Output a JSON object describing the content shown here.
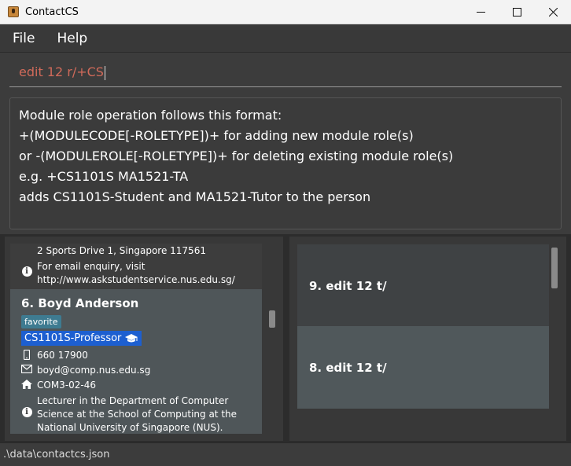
{
  "window": {
    "title": "ContactCS",
    "minimize": "—",
    "maximize": "☐",
    "close": "✕"
  },
  "menu": {
    "file": "File",
    "help": "Help"
  },
  "command": {
    "value": "edit 12 r/+CS"
  },
  "result": {
    "lines": [
      "Module role operation follows this format:",
      "+(MODULECODE[-ROLETYPE])+ for adding new module role(s)",
      "or -(MODULEROLE[-ROLETYPE])+ for deleting existing module role(s)",
      "e.g. +CS1101S MA1521-TA",
      "adds CS1101S-Student and MA1521-Tutor to the person"
    ]
  },
  "person_list": {
    "previous": {
      "address": "2 Sports Drive 1, Singapore 117561",
      "description_1": "For email enquiry, visit",
      "description_2": "http://www.askstudentservice.nus.edu.sg/"
    },
    "selected": {
      "name": "6. Boyd Anderson",
      "tag": "favorite",
      "role": "CS1101S-Professor",
      "role_icon": "graduation-cap-icon",
      "phone": "660 17900",
      "email": "boyd@comp.nus.edu.sg",
      "address": "COM3-02-46",
      "description_1": "Lecturer in the Department of Computer",
      "description_2": "Science at the School of Computing at the",
      "description_3": "National University of Singapore (NUS)."
    }
  },
  "history": {
    "items": [
      "9. edit 12 t/",
      "8. edit 12 t/"
    ]
  },
  "status": {
    "file_path": ".\\data\\contactcs.json"
  },
  "colors": {
    "background": "#3c3c3c",
    "command_text": "#d06a5a",
    "tag_favorite": "#3e7b91",
    "tag_role": "#1d5fd0",
    "selected_card": "#4f5659"
  }
}
